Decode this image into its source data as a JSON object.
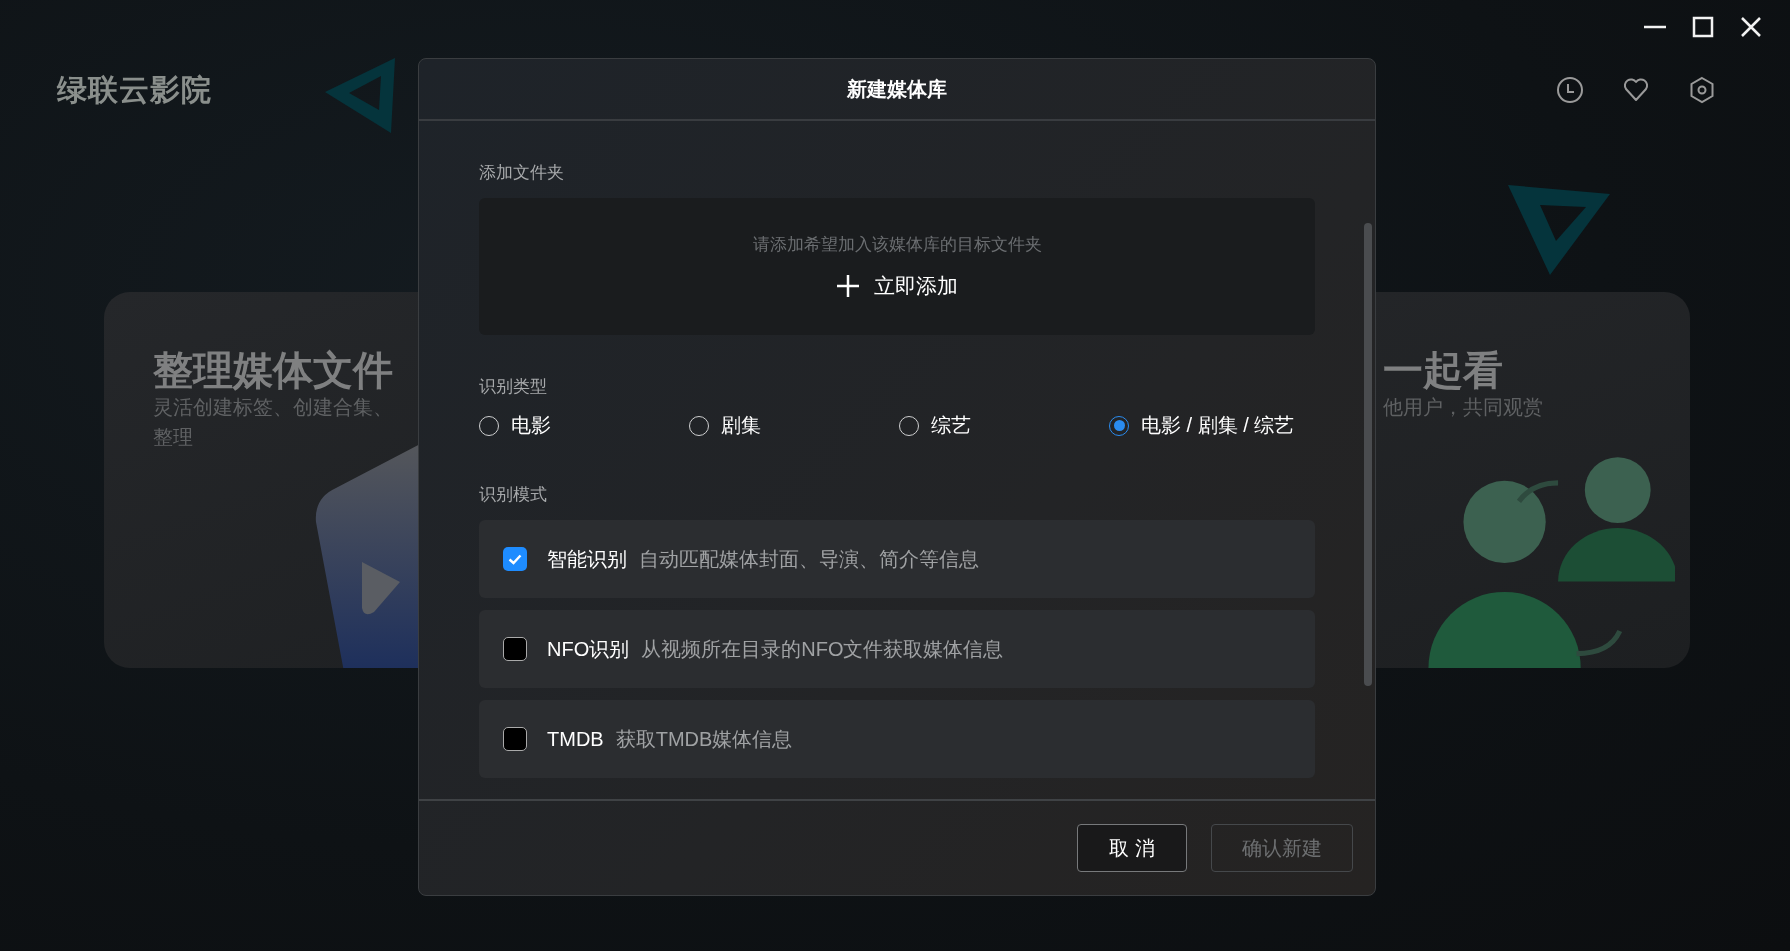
{
  "app": {
    "title": "绿联云影院"
  },
  "cards": [
    {
      "kind": "organize",
      "title": "整理媒体文件",
      "subtitle_lines": [
        "灵活创建标签、创建合集、",
        "整理"
      ]
    },
    {
      "kind": "together",
      "title": "一起看",
      "subtitle_lines": [
        "他用户，共同观赏"
      ]
    }
  ],
  "dialog": {
    "title": "新建媒体库",
    "folder_section": {
      "label": "添加文件夹",
      "hint": "请添加希望加入该媒体库的目标文件夹",
      "add_label": "立即添加"
    },
    "type_section": {
      "label": "识别类型",
      "options": [
        {
          "label": "电影",
          "selected": false
        },
        {
          "label": "剧集",
          "selected": false
        },
        {
          "label": "综艺",
          "selected": false
        },
        {
          "label": "电影 / 剧集 / 综艺",
          "selected": true
        }
      ]
    },
    "mode_section": {
      "label": "识别模式",
      "options": [
        {
          "title": "智能识别",
          "description": "自动匹配媒体封面、导演、简介等信息",
          "checked": true
        },
        {
          "title": "NFO识别",
          "description": "从视频所在目录的NFO文件获取媒体信息",
          "checked": false
        },
        {
          "title": "TMDB",
          "description": "获取TMDB媒体信息",
          "checked": false
        }
      ]
    },
    "buttons": [
      {
        "label": "取 消",
        "disabled": false
      },
      {
        "label": "确认新建",
        "disabled": true
      }
    ]
  }
}
